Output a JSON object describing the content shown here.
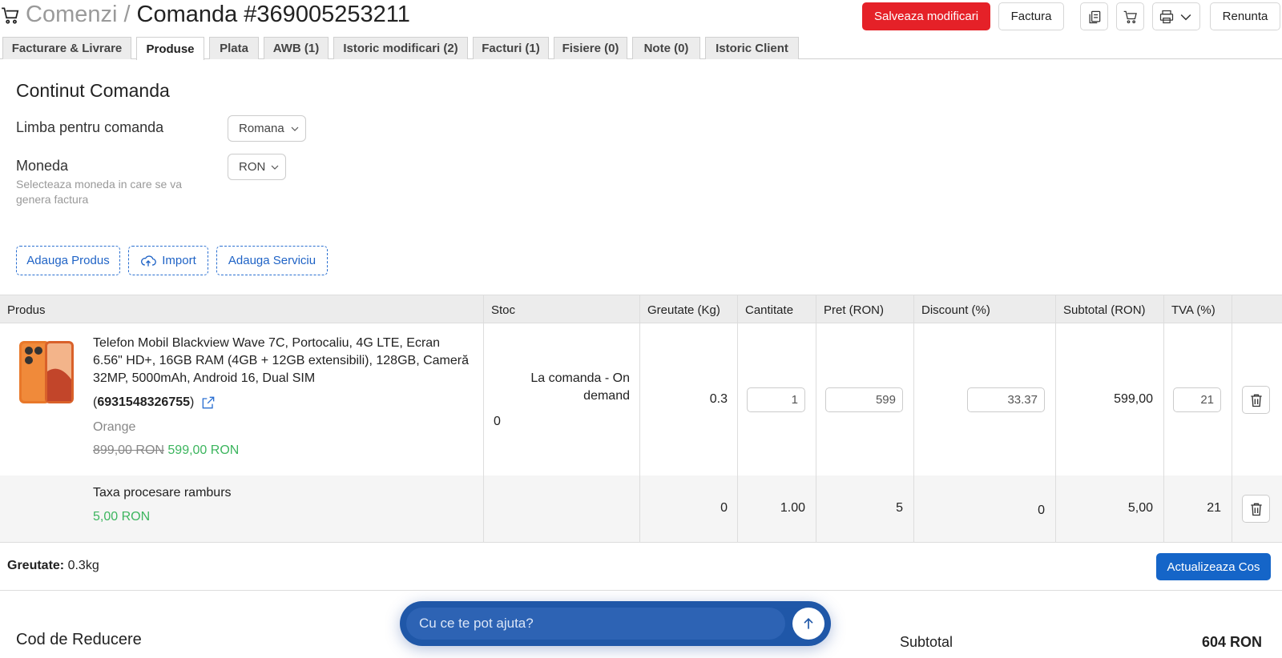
{
  "header": {
    "breadcrumb": "Comenzi",
    "separator": "/",
    "order_title": "Comanda #369005253211",
    "save_label": "Salveaza modificari",
    "invoice_label": "Factura",
    "cancel_label": "Renunta"
  },
  "tabs": [
    {
      "label": "Facturare & Livrare"
    },
    {
      "label": "Produse"
    },
    {
      "label": "Plata"
    },
    {
      "label": "AWB (1)"
    },
    {
      "label": "Istoric modificari (2)"
    },
    {
      "label": "Facturi (1)"
    },
    {
      "label": "Fisiere (0)"
    },
    {
      "label": "Note (0)"
    },
    {
      "label": "Istoric Client"
    }
  ],
  "content": {
    "title": "Continut Comanda",
    "language_label": "Limba pentru comanda",
    "language_value": "Romana",
    "currency_label": "Moneda",
    "currency_help": "Selecteaza moneda in care se va genera factura",
    "currency_value": "RON",
    "add_product": "Adauga Produs",
    "import": "Import",
    "add_service": "Adauga Serviciu"
  },
  "table": {
    "headers": [
      "Produs",
      "Stoc",
      "Greutate (Kg)",
      "Cantitate",
      "Pret (RON)",
      "Discount (%)",
      "Subtotal (RON)",
      "TVA (%)"
    ],
    "rows": [
      {
        "name": "Telefon Mobil Blackview Wave 7C, Portocaliu, 4G LTE, Ecran 6.56\" HD+, 16GB RAM (4GB + 12GB extensibili), 128GB, Cameră 32MP, 5000mAh, Android 16, Dual SIM",
        "sku_open": "(",
        "sku": "6931548326755",
        "sku_close": ")",
        "variant": "Orange",
        "old_price": "899,00 RON",
        "price": "599,00 RON",
        "stock_status": "La comanda - On demand",
        "stock_qty": "0",
        "weight": "0.3",
        "quantity": "1",
        "unit_price": "599",
        "discount": "33.37",
        "subtotal": "599,00",
        "vat": "21"
      },
      {
        "name": "Taxa procesare ramburs",
        "price": "5,00 RON",
        "weight": "0",
        "quantity": "1.00",
        "unit_price": "5",
        "discount": "0",
        "subtotal": "5,00",
        "vat": "21"
      }
    ]
  },
  "footer": {
    "weight_label": "Greutate:",
    "weight_value": "0.3kg",
    "update_cart": "Actualizeaza Cos",
    "discount_title": "Cod de Reducere",
    "subtotal_label": "Subtotal",
    "subtotal_value": "604 RON"
  },
  "chat": {
    "placeholder": "Cu ce te pot ajuta?"
  },
  "colors": {
    "primary_red": "#e52128",
    "primary_blue": "#1565c8",
    "price_green": "#3cb55e"
  }
}
